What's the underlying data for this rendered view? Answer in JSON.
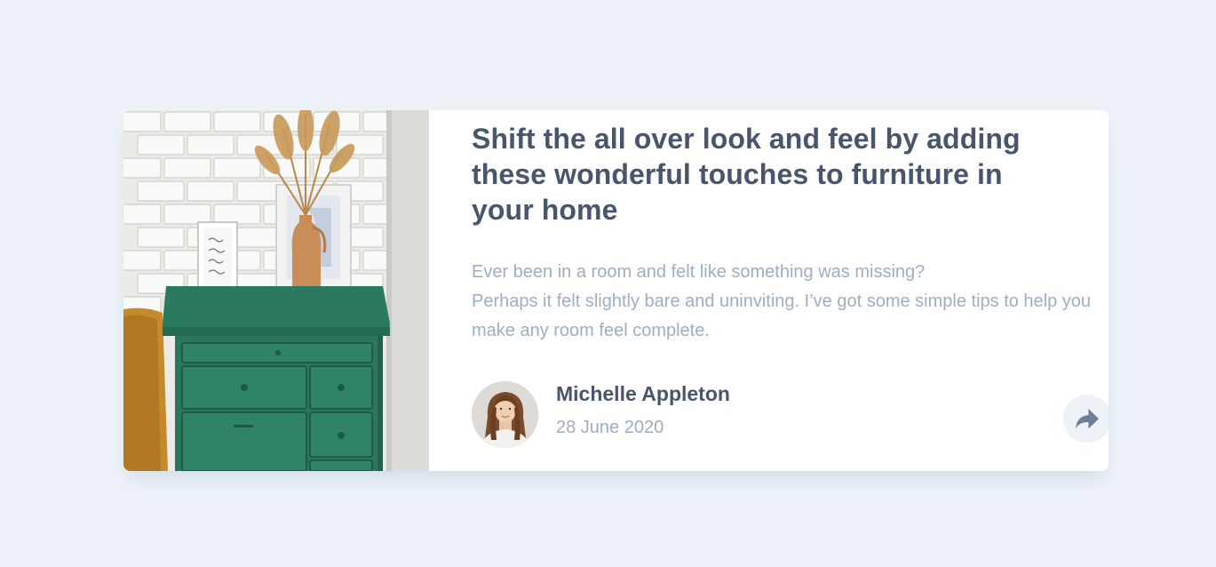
{
  "article": {
    "title": "Shift the all over look and feel by adding these wonderful touches to furniture in your home",
    "excerpt_line1": "Ever been in a room and felt like something was missing?",
    "excerpt_line2": "Perhaps it felt slightly bare and uninviting. I’ve got some simple tips to help you make any room feel complete."
  },
  "author": {
    "name": "Michelle Appleton",
    "date": "28 June 2020"
  },
  "colors": {
    "background": "#ECF2F8",
    "title": "#48556A",
    "muted_text": "#9DAEC2",
    "share_icon": "#6E8098",
    "drawer_green": "#2B775E"
  },
  "icons": {
    "share": "share-icon"
  }
}
